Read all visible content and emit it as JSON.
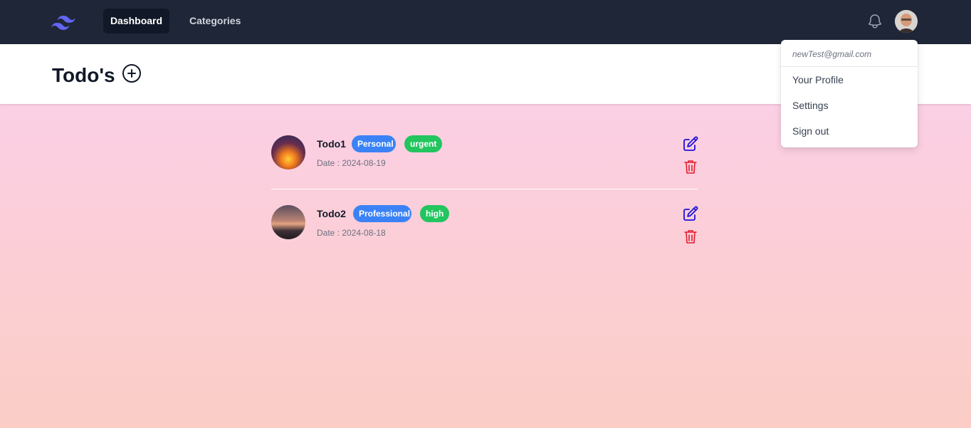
{
  "nav": {
    "links": [
      {
        "label": "Dashboard",
        "active": true
      },
      {
        "label": "Categories",
        "active": false
      }
    ],
    "brand_color": "#6366f1",
    "bg_color": "#1f2638"
  },
  "header": {
    "title": "Todo's"
  },
  "todos": [
    {
      "title": "Todo1",
      "tags": [
        "Personal",
        "urgent"
      ],
      "date": "Date : 2024-08-19"
    },
    {
      "title": "Todo2",
      "tags": [
        "Professional",
        "high"
      ],
      "date": "Date : 2024-08-18"
    }
  ],
  "user_menu": {
    "email": "newTest@gmail.com",
    "items": [
      "Your Profile",
      "Settings",
      "Sign out"
    ]
  },
  "colors": {
    "edit_icon": "#1d10d8",
    "delete_icon": "#e11d2a",
    "badge_category": "#3b82f6",
    "badge_priority": "#22c55e"
  },
  "icons": [
    "tailwind-logo-icon",
    "bell-icon",
    "plus-circle-icon",
    "edit-icon",
    "trash-icon"
  ]
}
